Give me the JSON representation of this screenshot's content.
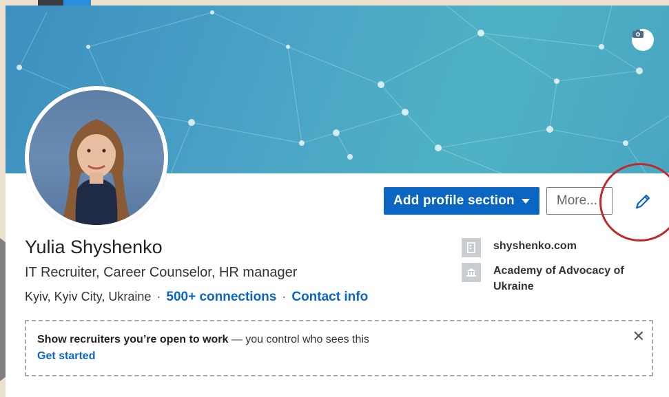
{
  "profile": {
    "name": "Yulia Shyshenko",
    "headline": "IT Recruiter, Career Counselor, HR manager",
    "location": "Kyiv, Kyiv City, Ukraine",
    "separator": "·",
    "connections": "500+ connections",
    "contact_info": "Contact info"
  },
  "actions": {
    "add_section_label": "Add profile section",
    "more_label": "More..."
  },
  "side": {
    "website": "shyshenko.com",
    "education": "Academy of Advocacy of Ukraine"
  },
  "open_to_work": {
    "bold_text": "Show recruiters you’re open to work",
    "rest_text": " — you control who sees this",
    "cta": "Get started",
    "close": "✕"
  },
  "icons": {
    "camera": "camera-icon",
    "pencil": "pencil-icon",
    "company": "building-icon",
    "school": "school-icon"
  },
  "colors": {
    "accent": "#0a66c2",
    "banner": "#4aa3c6",
    "annotation": "#c0282b"
  }
}
